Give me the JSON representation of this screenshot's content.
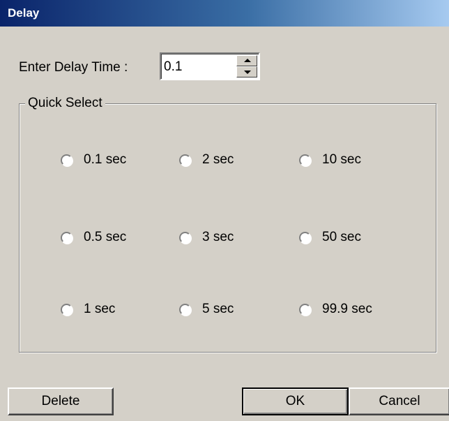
{
  "window": {
    "title": "Delay"
  },
  "delay": {
    "label": "Enter Delay Time :",
    "value": "0.1"
  },
  "quick_select": {
    "title": "Quick Select",
    "options": [
      "0.1 sec",
      "2 sec",
      "10 sec",
      "0.5 sec",
      "3 sec",
      "50 sec",
      "1 sec",
      "5 sec",
      "99.9 sec"
    ],
    "selected": null
  },
  "buttons": {
    "delete": "Delete",
    "ok": "OK",
    "cancel": "Cancel"
  },
  "colors": {
    "dialog_bg": "#d4d0c8",
    "titlebar_start": "#0a246a",
    "titlebar_end": "#a6caf0"
  },
  "icons": [
    "spin-up-arrow-icon",
    "spin-down-arrow-icon",
    "radio-unselected-icon"
  ]
}
